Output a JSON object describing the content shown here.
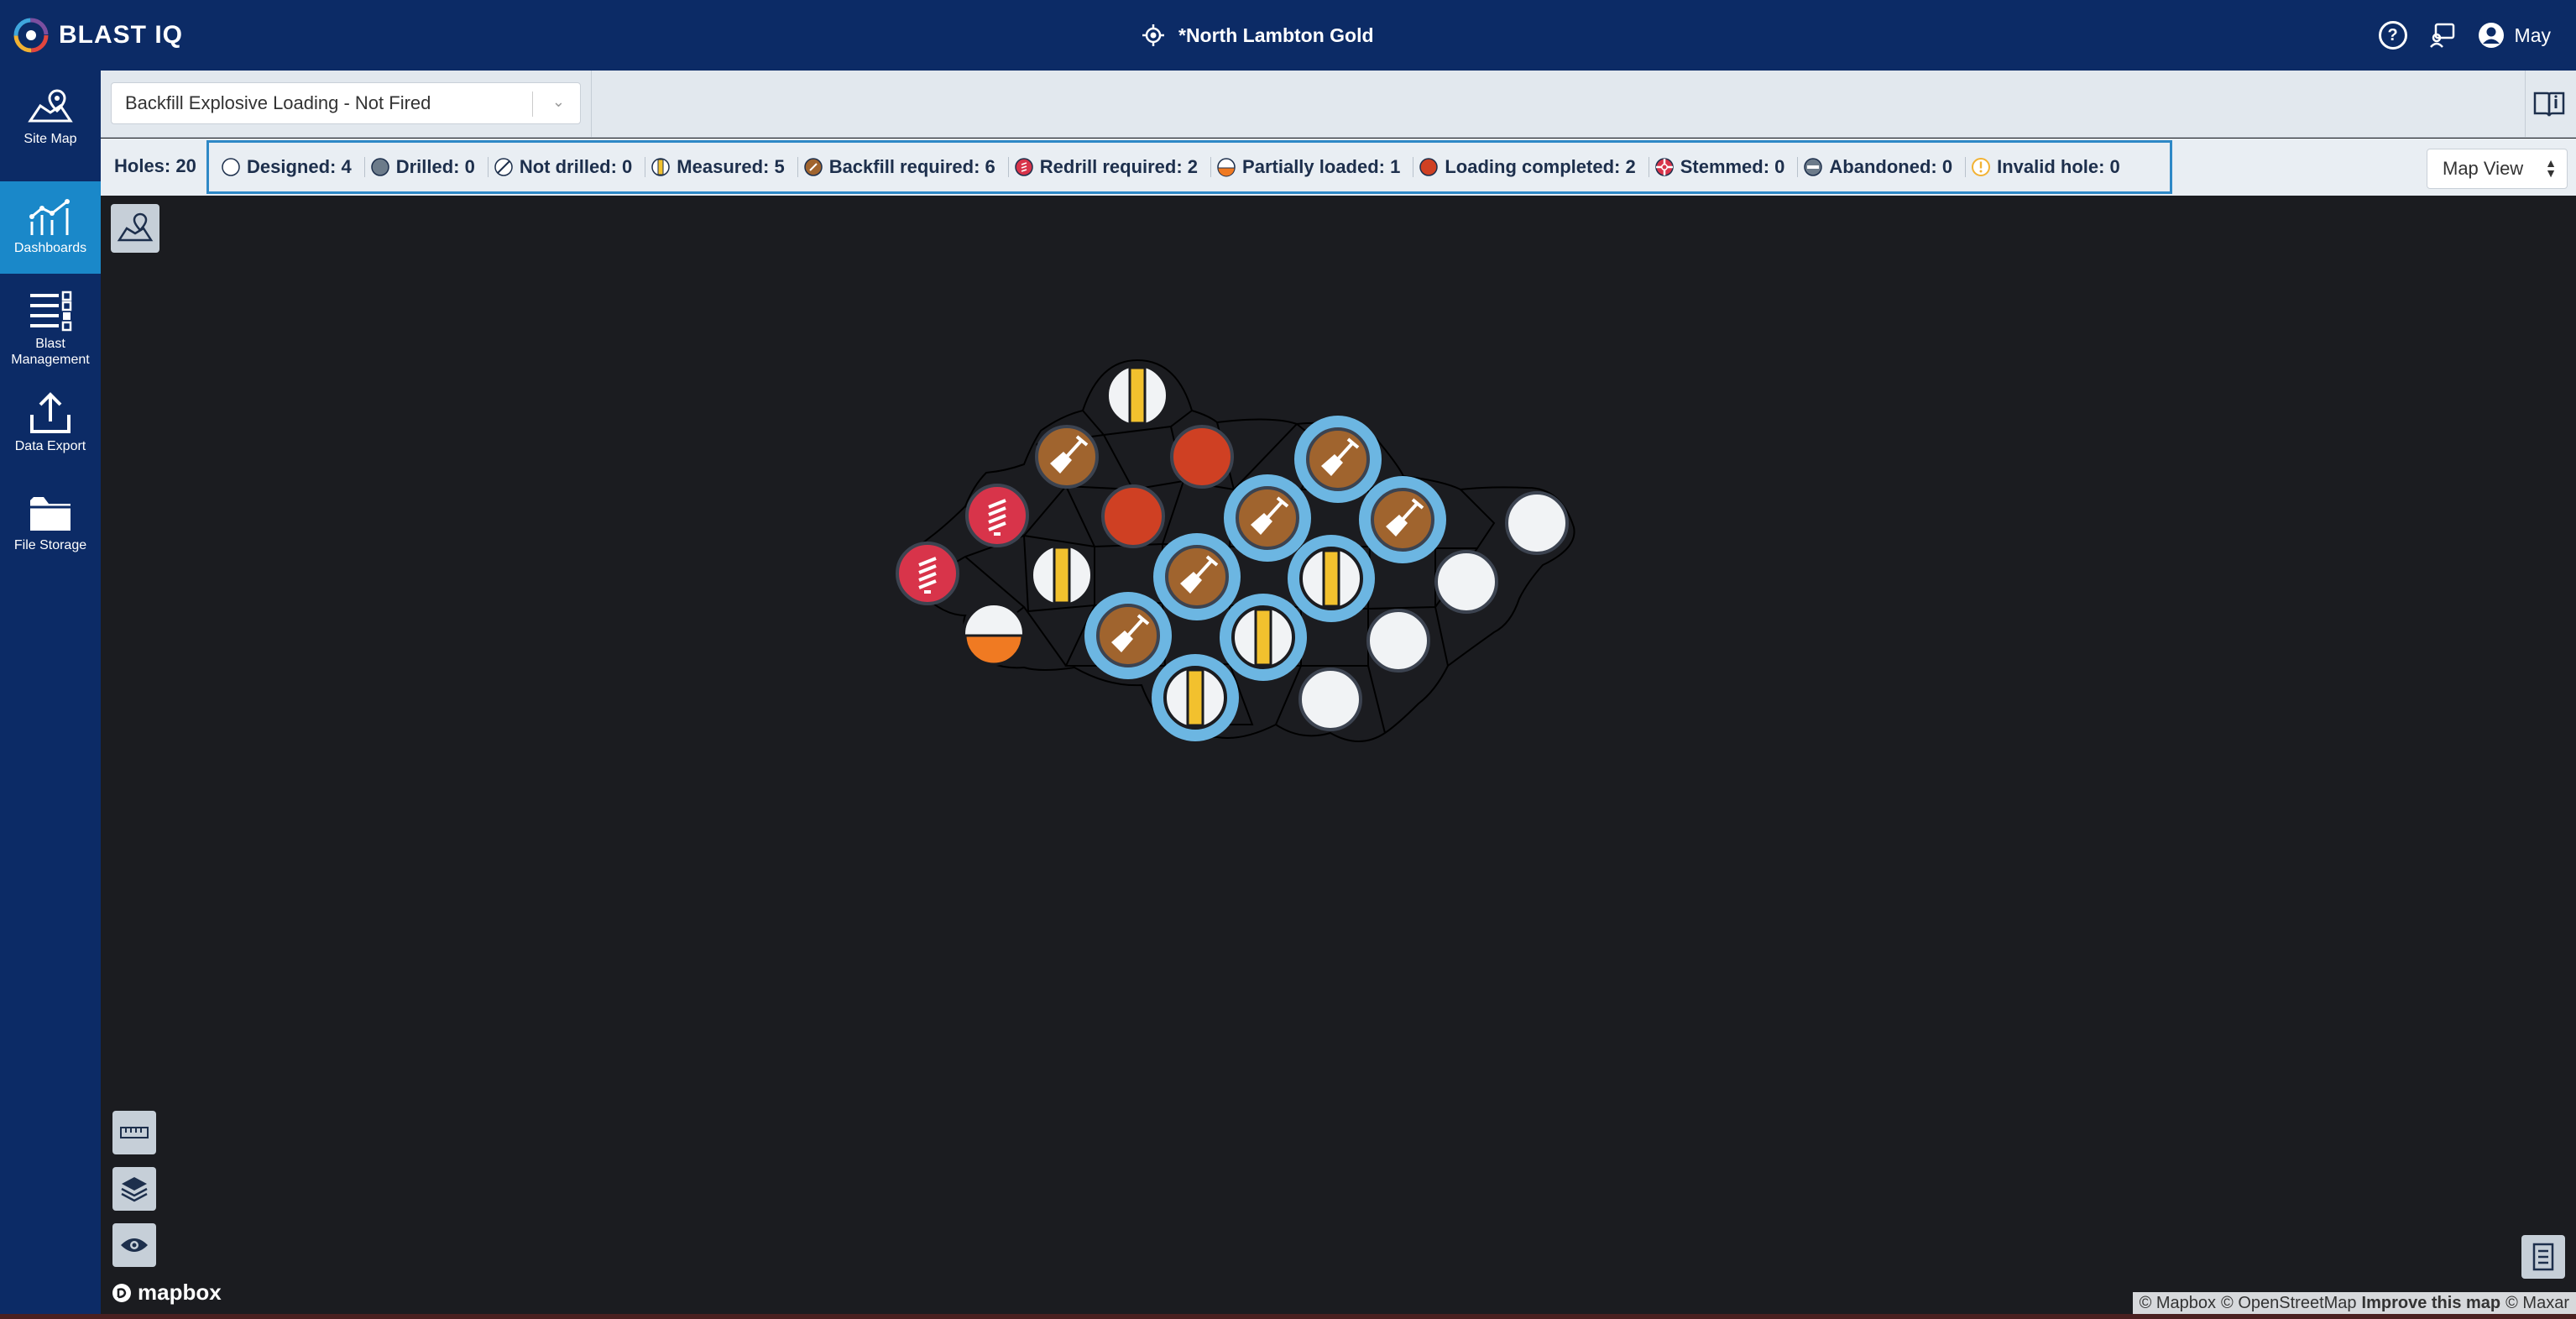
{
  "app": {
    "brand": "BLAST IQ"
  },
  "header": {
    "site_name": "*North Lambton Gold",
    "help_label": "?",
    "user_name": "May"
  },
  "sidebar": {
    "items": [
      {
        "label": "Site Map",
        "icon": "map-pin-icon"
      },
      {
        "label": "Dashboards",
        "icon": "dashboard-chart-icon"
      },
      {
        "label": "Blast Management",
        "icon": "list-icon"
      },
      {
        "label": "Data Export",
        "icon": "upload-icon"
      },
      {
        "label": "File Storage",
        "icon": "folder-icon"
      }
    ],
    "active": "Dashboards"
  },
  "controls": {
    "dashboard_view": "Backfill Explosive Loading - Not Fired",
    "map_view": "Map View"
  },
  "stats": {
    "holes_total": "Holes: 20",
    "statuses": [
      {
        "label": "Designed: 4",
        "icon": "designed-icon"
      },
      {
        "label": "Drilled: 0",
        "icon": "drilled-icon"
      },
      {
        "label": "Not drilled: 0",
        "icon": "not-drilled-icon"
      },
      {
        "label": "Measured: 5",
        "icon": "measured-icon"
      },
      {
        "label": "Backfill required: 6",
        "icon": "backfill-required-icon"
      },
      {
        "label": "Redrill required: 2",
        "icon": "redrill-required-icon"
      },
      {
        "label": "Partially loaded: 1",
        "icon": "partially-loaded-icon"
      },
      {
        "label": "Loading completed: 2",
        "icon": "loading-completed-icon"
      },
      {
        "label": "Stemmed: 0",
        "icon": "stemmed-icon"
      },
      {
        "label": "Abandoned: 0",
        "icon": "abandoned-icon"
      },
      {
        "label": "Invalid hole: 0",
        "icon": "invalid-hole-icon"
      }
    ]
  },
  "map": {
    "logo": "mapbox",
    "attribution": {
      "mapbox": "© Mapbox",
      "osm": "© OpenStreetMap",
      "improve": "Improve this map",
      "maxar": "© Maxar"
    },
    "holes": [
      {
        "status": "measured",
        "selected": false
      },
      {
        "status": "backfill",
        "selected": false
      },
      {
        "status": "loading-completed",
        "selected": false
      },
      {
        "status": "backfill",
        "selected": true
      },
      {
        "status": "redrill",
        "selected": false
      },
      {
        "status": "loading-completed",
        "selected": false
      },
      {
        "status": "backfill",
        "selected": true
      },
      {
        "status": "backfill",
        "selected": true
      },
      {
        "status": "designed",
        "selected": false
      },
      {
        "status": "redrill",
        "selected": false
      },
      {
        "status": "measured",
        "selected": false
      },
      {
        "status": "backfill",
        "selected": true
      },
      {
        "status": "measured",
        "selected": true
      },
      {
        "status": "designed",
        "selected": false
      },
      {
        "status": "partially-loaded",
        "selected": false
      },
      {
        "status": "backfill",
        "selected": true
      },
      {
        "status": "measured",
        "selected": true
      },
      {
        "status": "designed",
        "selected": false
      },
      {
        "status": "measured",
        "selected": true
      },
      {
        "status": "designed",
        "selected": false
      }
    ]
  },
  "colors": {
    "header_bg": "#0c2b66",
    "active_nav": "#1a88c9",
    "highlight_border": "#2e88c6",
    "backfill": "#a0642e",
    "loading_completed": "#cf4023",
    "redrill": "#d8344a",
    "measured_yellow": "#f2c12e",
    "partial_orange": "#f07a22",
    "selected_ring": "#6cb6e2"
  }
}
